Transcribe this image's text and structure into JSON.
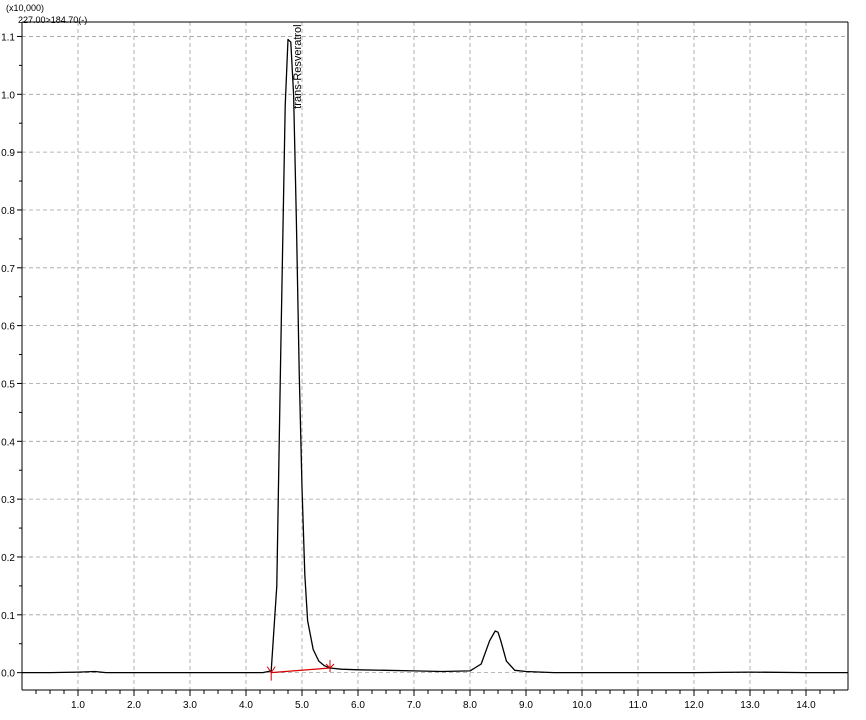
{
  "chart_data": {
    "type": "line",
    "y_multiplier_label": "(x10,000)",
    "channel_label": "227.00>184.70(-)",
    "x_tick_labels": [
      "1.0",
      "2.0",
      "3.0",
      "4.0",
      "5.0",
      "6.0",
      "7.0",
      "8.0",
      "9.0",
      "10.0",
      "11.0",
      "12.0",
      "13.0",
      "14.0"
    ],
    "y_tick_labels": [
      "0.0",
      "0.1",
      "0.2",
      "0.3",
      "0.4",
      "0.5",
      "0.6",
      "0.7",
      "0.8",
      "0.9",
      "1.0",
      "1.1"
    ],
    "xlim": [
      0.0,
      14.75
    ],
    "ylim": [
      -0.03,
      1.125
    ],
    "grid": true,
    "series": [
      {
        "color": "#000000",
        "x": [
          0.0,
          0.5,
          1.0,
          1.3,
          1.5,
          2.0,
          2.5,
          3.0,
          3.5,
          4.0,
          4.3,
          4.45,
          4.55,
          4.62,
          4.7,
          4.75,
          4.8,
          4.85,
          4.9,
          4.95,
          5.0,
          5.05,
          5.1,
          5.2,
          5.3,
          5.4,
          5.5,
          5.7,
          6.0,
          6.5,
          7.0,
          7.5,
          8.0,
          8.2,
          8.35,
          8.45,
          8.5,
          8.55,
          8.65,
          8.8,
          9.0,
          9.5,
          10.0,
          11.0,
          12.0,
          13.0,
          14.0,
          14.75
        ],
        "y": [
          0.0,
          0.0,
          0.001,
          0.002,
          0.0,
          0.0,
          0.0,
          0.0,
          0.0,
          0.0,
          0.0,
          0.003,
          0.15,
          0.55,
          0.98,
          1.095,
          1.09,
          1.0,
          0.78,
          0.52,
          0.32,
          0.17,
          0.09,
          0.04,
          0.02,
          0.012,
          0.008,
          0.006,
          0.005,
          0.004,
          0.003,
          0.002,
          0.003,
          0.015,
          0.055,
          0.072,
          0.07,
          0.055,
          0.02,
          0.004,
          0.002,
          0.0,
          0.0,
          0.0,
          0.0,
          0.001,
          0.0,
          0.0
        ]
      }
    ],
    "peaks": [
      {
        "label": "trans-Resveratrol",
        "x": 4.8
      }
    ],
    "baseline": {
      "color": "#d40000",
      "x": [
        4.45,
        5.5
      ],
      "y": [
        0.0,
        0.008
      ]
    }
  }
}
